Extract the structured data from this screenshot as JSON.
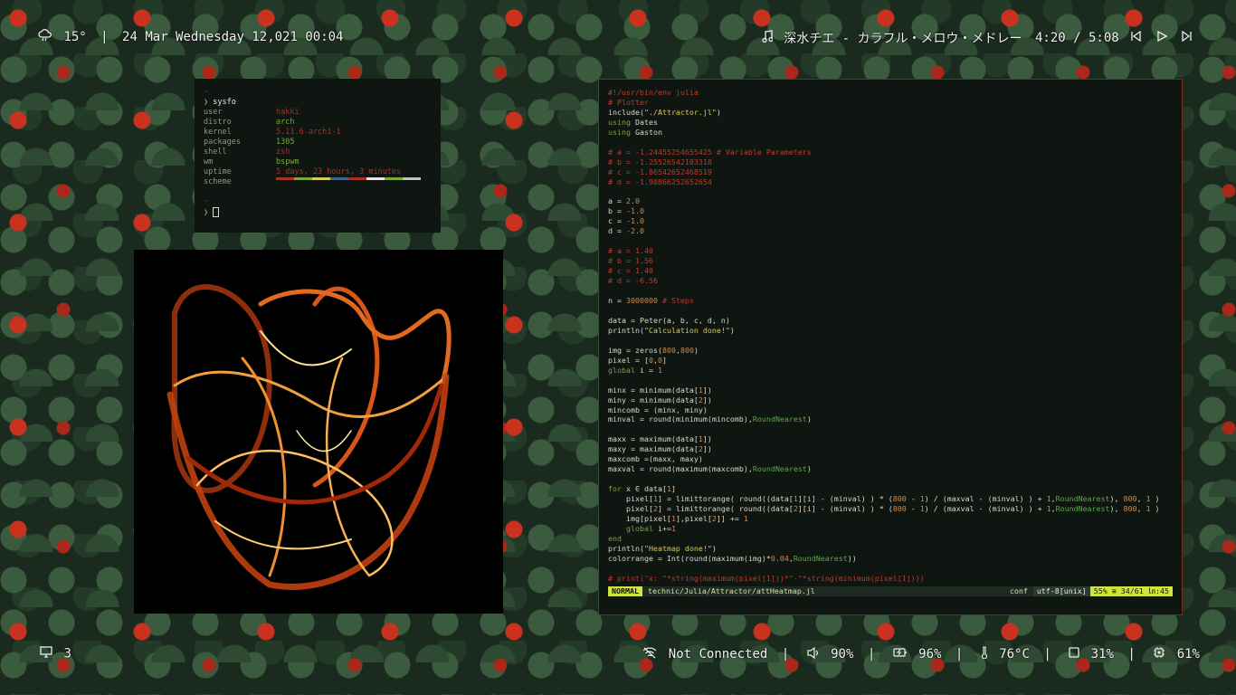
{
  "topbar": {
    "weather_icon": "cloud-rain-icon",
    "temperature": "15°",
    "separator": "|",
    "datetime": "24 Mar Wednesday 12,021 00:04",
    "music_icon": "music-note-icon",
    "track": "深水チエ - カラフル・メロウ・メドレー",
    "time": "4:20 / 5:08"
  },
  "bottombar": {
    "workspace_icon": "monitor-icon",
    "workspace": "3",
    "wifi": "Not Connected",
    "volume": "90%",
    "battery": "96%",
    "temperature": "76°C",
    "memory": "31%",
    "cpu": "61%",
    "sep": "|"
  },
  "sysfo": {
    "prompt_dir": "~",
    "command": "sysfo",
    "rows": [
      {
        "k": "user",
        "v": "hakki"
      },
      {
        "k": "distro",
        "v": "arch"
      },
      {
        "k": "kernel",
        "v": "5.11.6-arch1-1"
      },
      {
        "k": "packages",
        "v": "1305"
      },
      {
        "k": "shell",
        "v": "zsh"
      },
      {
        "k": "wm",
        "v": "bspwm"
      },
      {
        "k": "uptime",
        "v": "5 days, 23 hours, 3 minutes"
      }
    ],
    "scheme_label": "scheme",
    "scheme_colors": [
      "#a83020",
      "#7aaa3a",
      "#d8c860",
      "#3a6a8a",
      "#a83020",
      "#e8e8e8",
      "#7aaa3a",
      "#c0c0c0"
    ],
    "prompt2_dir": "~"
  },
  "editor": {
    "mode": "NORMAL",
    "filename": "technic/Julia/Attractor/attHeatmap.jl",
    "filetype": "conf",
    "encoding": "utf-8[unix]",
    "position": "55% ≡ 34/61 ㏑:45"
  }
}
